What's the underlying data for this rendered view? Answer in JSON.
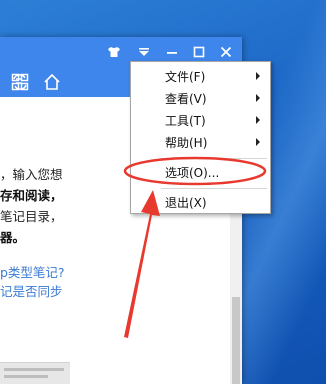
{
  "window": {
    "content_lines": [
      "，输入您想",
      "存和阅读，",
      "笔记目录，",
      "器。",
      "p类型笔记?",
      "记是否同步"
    ]
  },
  "titlebar": {
    "icons": [
      "tshirt-icon",
      "menu-icon",
      "minimize-icon",
      "maximize-icon",
      "close-icon"
    ]
  },
  "toolbar": {
    "icons": [
      "sync-icon",
      "grid-icon",
      "home-icon"
    ]
  },
  "menu": {
    "items": [
      {
        "label": "文件(F)",
        "submenu": true
      },
      {
        "label": "查看(V)",
        "submenu": true
      },
      {
        "label": "工具(T)",
        "submenu": true
      },
      {
        "label": "帮助(H)",
        "submenu": true
      },
      {
        "label": "选项(O)...",
        "submenu": false
      },
      {
        "label": "退出(X)",
        "submenu": false
      }
    ]
  },
  "annotation": {
    "highlight_color": "#e8392f",
    "arrow_color": "#e8392f"
  }
}
